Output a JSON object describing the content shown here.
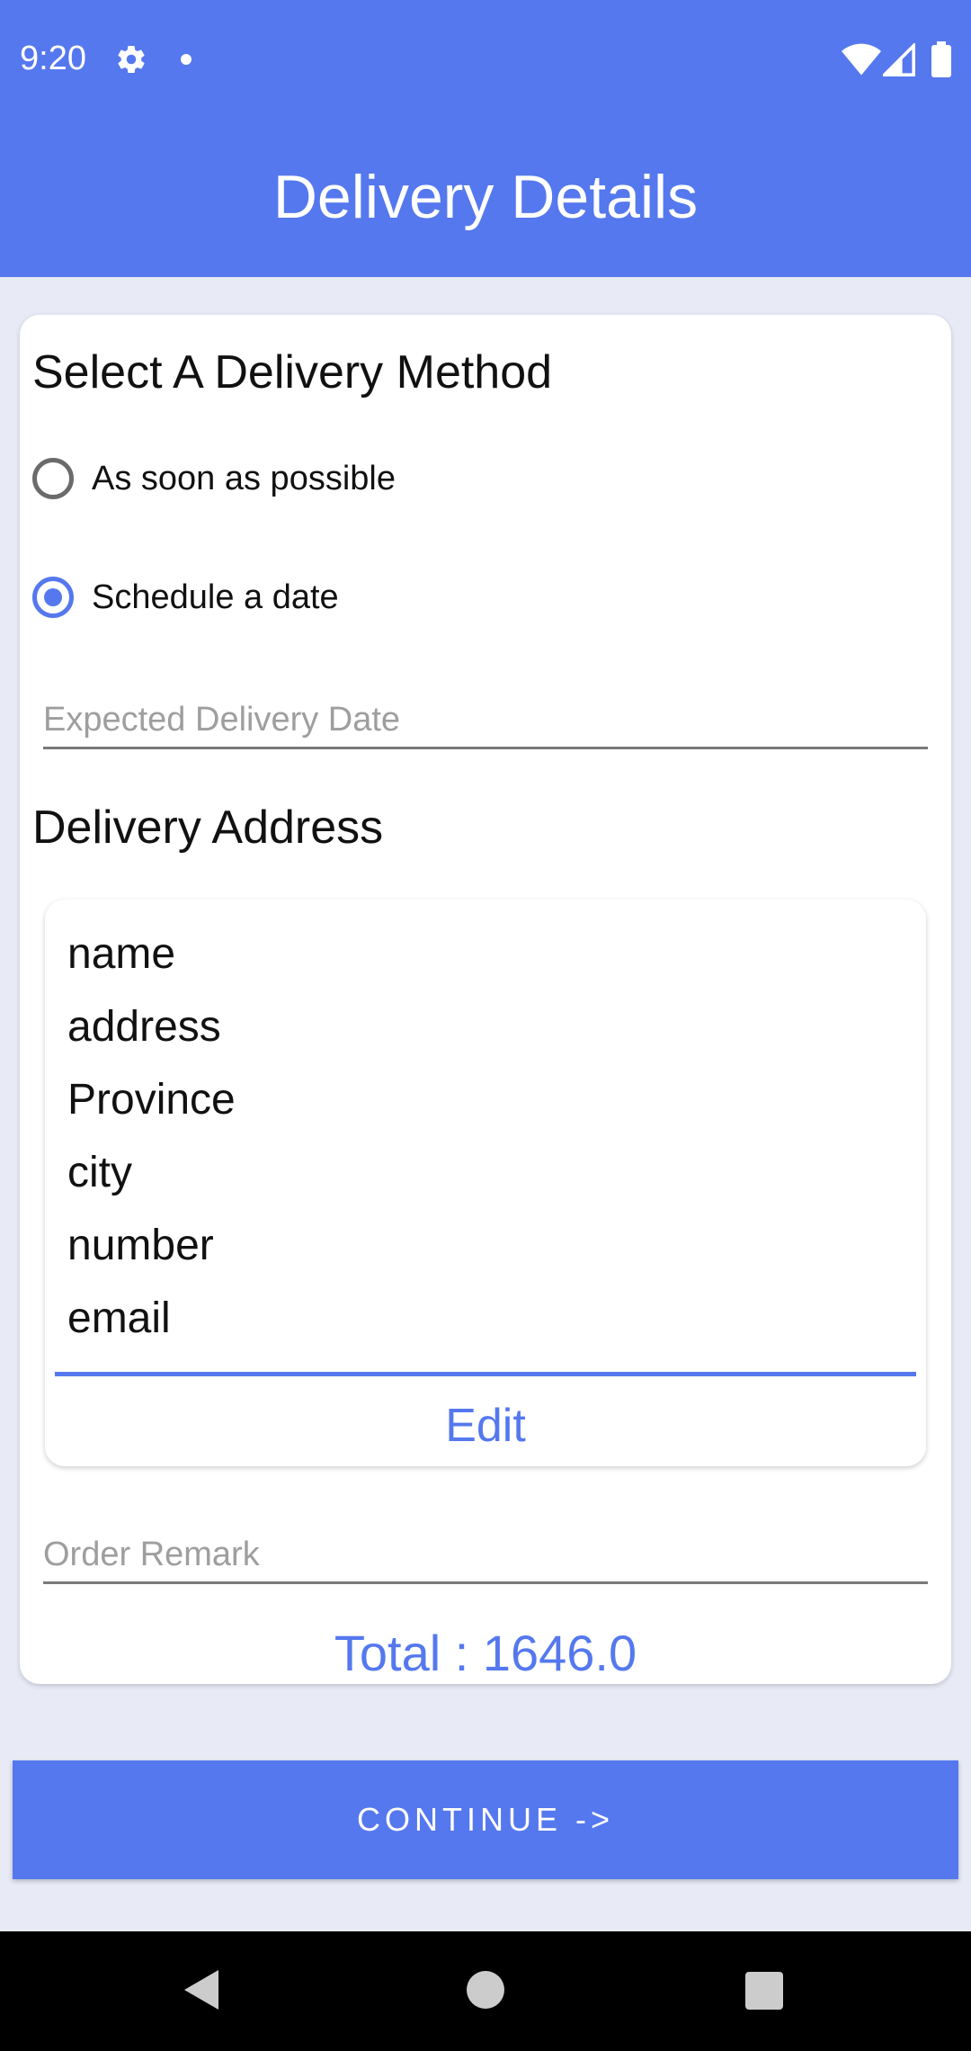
{
  "status_bar": {
    "time": "9:20"
  },
  "header": {
    "title": "Delivery Details"
  },
  "delivery_method": {
    "heading": "Select A Delivery Method",
    "options": [
      {
        "label": "As soon as possible",
        "selected": false
      },
      {
        "label": "Schedule a date",
        "selected": true
      }
    ],
    "date_placeholder": "Expected Delivery Date"
  },
  "address": {
    "heading": "Delivery Address",
    "lines": [
      "name",
      "address",
      "Province",
      "city",
      "number",
      "email"
    ],
    "edit_label": "Edit"
  },
  "remark_placeholder": "Order Remark",
  "total_text": "Total : 1646.0",
  "continue_label": "CONTINUE ->",
  "colors": {
    "accent": "#5578ee",
    "background": "#e8eaf6"
  }
}
